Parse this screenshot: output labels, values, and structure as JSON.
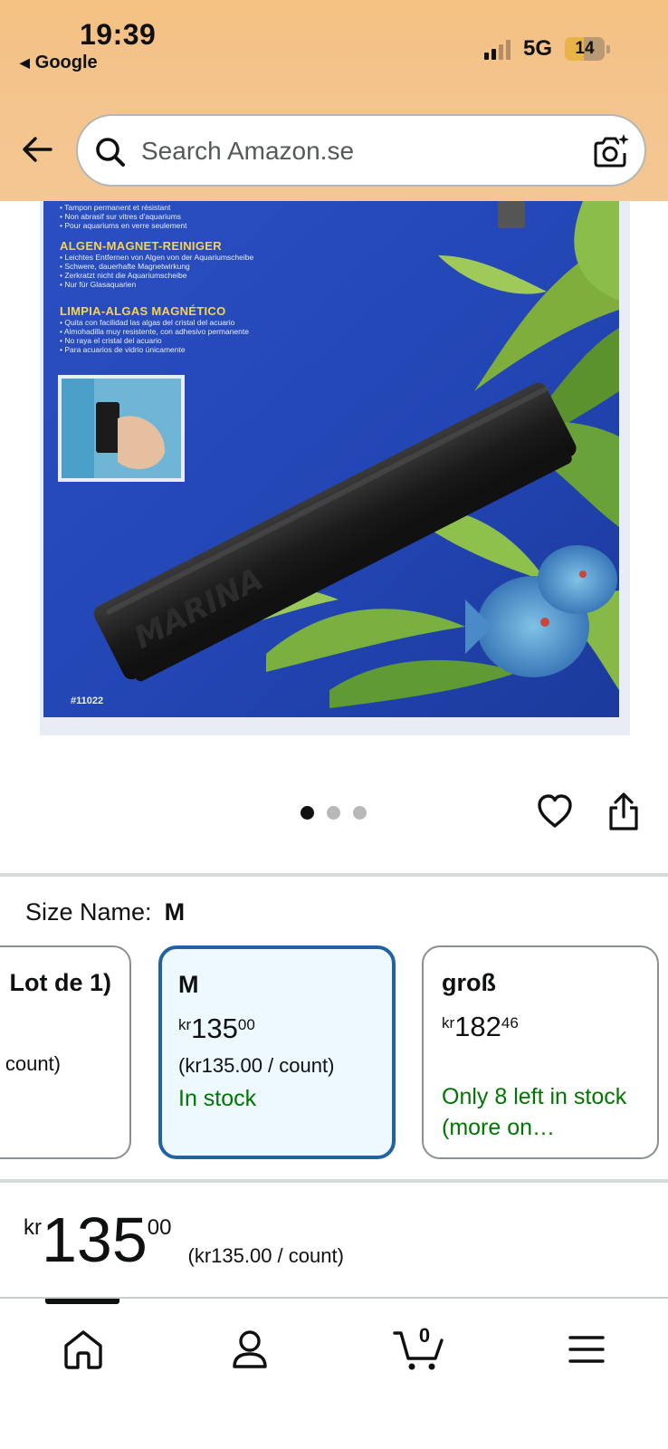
{
  "status_bar": {
    "time": "19:39",
    "back_app": "Google",
    "network": "5G",
    "battery": "14"
  },
  "search": {
    "placeholder": "Search Amazon.se"
  },
  "product_image": {
    "package_text": {
      "line1": "• Tampon permanent et résistant",
      "line2": "• Non abrasif sur vitres d'aquariums",
      "line3": "• Pour aquariums en verre seulement",
      "heading_de": "ALGEN-MAGNET-REINIGER",
      "de1": "• Leichtes Entfernen von Algen von der Aquariumscheibe",
      "de2": "• Schwere, dauerhafte Magnetwirkung",
      "de3": "• Zerkratzt nicht die Aquariumscheibe",
      "de4": "• Nur für Glasaquarien",
      "heading_es": "LIMPIA-ALGAS MAGNÉTICO",
      "es1": "• Quita con facilidad las algas del cristal del acuario",
      "es2": "• Almohadilla muy resistente, con adhesivo permanente",
      "es3": "• No raya el cristal del acuario",
      "es4": "• Para acuarios de vidrio únicamente",
      "code": "#11022"
    },
    "carousel_index": 1,
    "carousel_total": 3
  },
  "size": {
    "label": "Size Name:",
    "selected": "M",
    "options": [
      {
        "title": "Lot de 1)",
        "unit": "count)"
      },
      {
        "title": "M",
        "currency": "kr",
        "whole": "135",
        "fraction": "00",
        "unit": "(kr135.00 / count)",
        "stock": "In stock"
      },
      {
        "title": "groß",
        "currency": "kr",
        "whole": "182",
        "fraction": "46",
        "stock": "Only 8 left in stock (more on…"
      }
    ]
  },
  "price": {
    "currency": "kr",
    "whole": "135",
    "fraction": "00",
    "unit": "(kr135.00 / count)"
  },
  "bottom_nav": {
    "cart_count": "0"
  },
  "colors": {
    "header_bg": "#f4c38c",
    "selected_border": "#2162a1",
    "selected_bg": "#edf8ff",
    "stock_green": "#007600"
  }
}
